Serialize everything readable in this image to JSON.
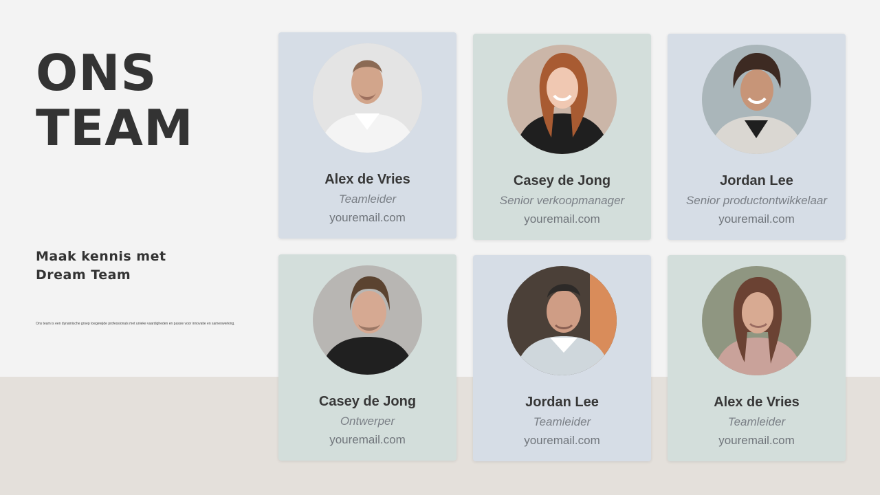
{
  "page": {
    "title_lines": [
      "ONS",
      "TEAM"
    ],
    "subtitle_lines": [
      "Maak kennis met",
      "Dream Team"
    ],
    "description": "Ons team is een dynamische groep toegewijde professionals met unieke vaardigheden en passie voor innovatie en samenwerking."
  },
  "team": [
    {
      "name": "Alex de Vries",
      "role": "Teamleider",
      "email": "youremail.com"
    },
    {
      "name": "Casey de Jong",
      "role": "Senior verkoopmanager",
      "email": "youremail.com"
    },
    {
      "name": "Jordan Lee",
      "role": "Senior productontwikkelaar",
      "email": "youremail.com"
    },
    {
      "name": "Casey de Jong",
      "role": "Ontwerper",
      "email": "youremail.com"
    },
    {
      "name": "Jordan Lee",
      "role": "Teamleider",
      "email": "youremail.com"
    },
    {
      "name": "Alex de Vries",
      "role": "Teamleider",
      "email": "youremail.com"
    }
  ],
  "colors": {
    "page_background": "#f3f3f3",
    "bottom_band": "#e4e0db",
    "card_blue": "#d6dde6",
    "card_green": "#d3dedb",
    "text_dark": "#333333",
    "text_muted": "#7a7f86"
  }
}
